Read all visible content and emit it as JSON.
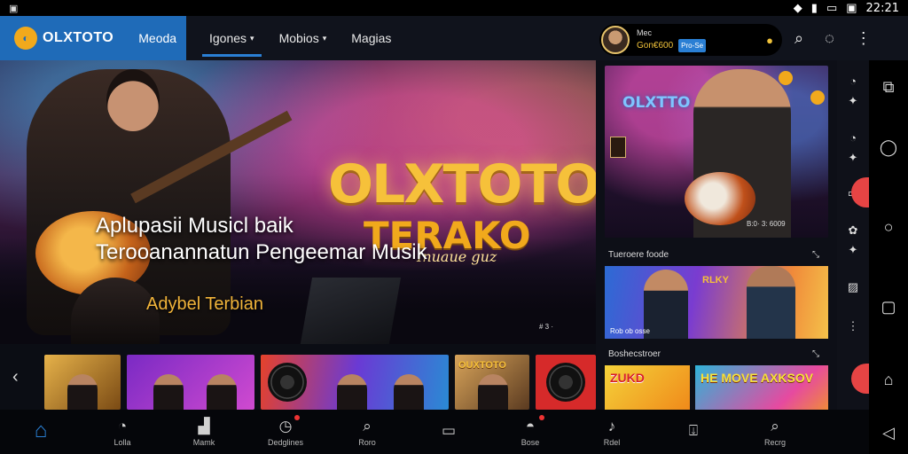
{
  "status": {
    "left": "▣",
    "time": "22:21"
  },
  "nav": {
    "brand": "OLXTOTO",
    "brand_tab": "Meoda",
    "tabs": [
      {
        "label": "Igones",
        "caret": "▾",
        "active": true
      },
      {
        "label": "Mobios",
        "caret": "▾",
        "active": false
      },
      {
        "label": "Magias",
        "caret": "",
        "active": false
      }
    ]
  },
  "profile": {
    "name": "Mec",
    "coins": "Gon€600",
    "badge": "Pro-Se"
  },
  "hero": {
    "logo": "OLXTOTO",
    "logo_sub": "TERAKO",
    "logo_tag": "Inuaue guz",
    "headline_1": "Aplupasii Musicl baik",
    "headline_2": "Terooanannatun Pengeemar Musik",
    "tagline": "Adybel Terbian",
    "footnote": "# 3 ·"
  },
  "rail_thumbs": [
    {
      "title": ""
    },
    {
      "title": ""
    },
    {
      "title": ""
    },
    {
      "title": ""
    },
    {
      "title": "OUXTOTO"
    },
    {
      "title": ""
    }
  ],
  "right": {
    "feature_title": "OLXTTO",
    "feature_code": "B:0· 3: 6009",
    "section1": "Tueroere foode",
    "section2": "Boshecstroer",
    "card2_tag": "RLKY",
    "card2_foot": "Rob ob osse",
    "card3_a": "ZUKD",
    "card3_b": "HE MOVE AXKSOV"
  },
  "bottom": [
    {
      "icon": "⌂",
      "label": "",
      "active": true,
      "dot": false
    },
    {
      "icon": "◔",
      "label": "Lolla",
      "active": false,
      "dot": false
    },
    {
      "icon": "▟",
      "label": "Mamk",
      "active": false,
      "dot": false
    },
    {
      "icon": "◷",
      "label": "Dedglines",
      "active": false,
      "dot": true
    },
    {
      "icon": "⌕",
      "label": "Roro",
      "active": false,
      "dot": false
    },
    {
      "icon": "▭",
      "label": "",
      "active": false,
      "dot": false
    },
    {
      "icon": "◓",
      "label": "Bose",
      "active": false,
      "dot": true
    },
    {
      "icon": "♪",
      "label": "Rdel",
      "active": false,
      "dot": false
    },
    {
      "icon": "⍗",
      "label": "",
      "active": false,
      "dot": false
    },
    {
      "icon": "⌕",
      "label": "Recrg",
      "active": false,
      "dot": false
    }
  ]
}
